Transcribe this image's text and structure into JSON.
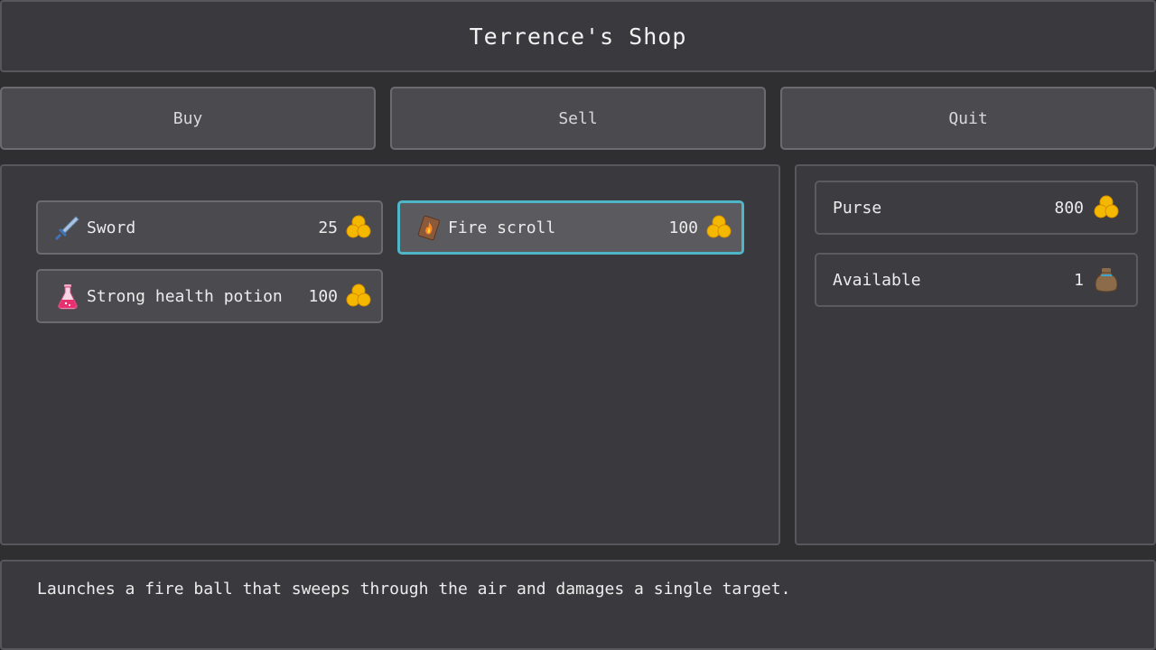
{
  "title": "Terrence's Shop",
  "menu": {
    "buy_label": "Buy",
    "sell_label": "Sell",
    "quit_label": "Quit"
  },
  "items": [
    {
      "name": "Sword",
      "price": "25",
      "icon": "sword-icon",
      "selected": false
    },
    {
      "name": "Fire scroll",
      "price": "100",
      "icon": "fire-scroll-icon",
      "selected": true
    },
    {
      "name": "Strong health potion",
      "price": "100",
      "icon": "potion-icon",
      "selected": false
    }
  ],
  "purse": {
    "label": "Purse",
    "value": "800",
    "icon": "gold-coins-icon"
  },
  "available": {
    "label": "Available",
    "value": "1",
    "icon": "bag-icon"
  },
  "description": "Launches a fire ball that sweeps through the air and damages a single target.",
  "colors": {
    "background": "#2f2f31",
    "panel": "#3a393d",
    "selected_border": "#4fb6c8",
    "gold": "#f5b800"
  }
}
